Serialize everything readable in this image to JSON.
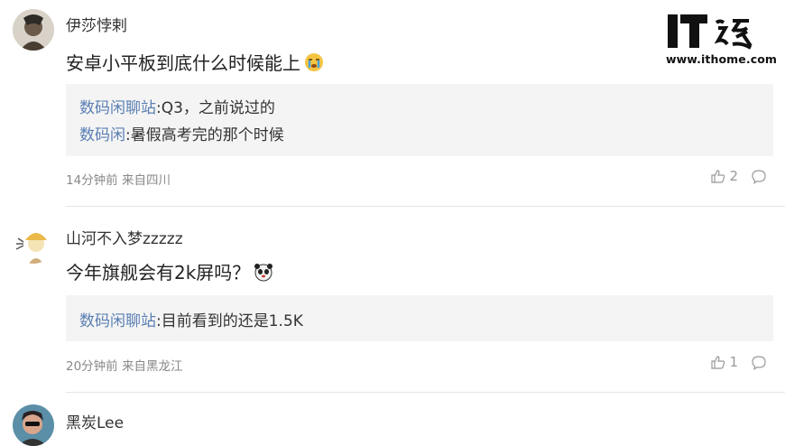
{
  "logo": {
    "brand": "IT之家",
    "url": "www.ithome.com"
  },
  "comments": [
    {
      "username": "伊莎悖剌",
      "text": "安卓小平板到底什么时候能上",
      "emoji": "crying-emoji",
      "replies": [
        {
          "name": "数码闲聊站",
          "text": ":Q3，之前说过的"
        },
        {
          "name": "数码闲",
          "text": ":暑假高考完的那个时候"
        }
      ],
      "meta": "14分钟前 来自四川",
      "likes": "2"
    },
    {
      "username": "山河不入梦zzzzz",
      "text": "今年旗舰会有2k屏吗？",
      "emoji": "panda-emoji",
      "replies": [
        {
          "name": "数码闲聊站",
          "text": ":目前看到的还是1.5K"
        }
      ],
      "meta": "20分钟前 来自黑龙江",
      "likes": "1"
    },
    {
      "username": "黑炭Lee"
    }
  ]
}
